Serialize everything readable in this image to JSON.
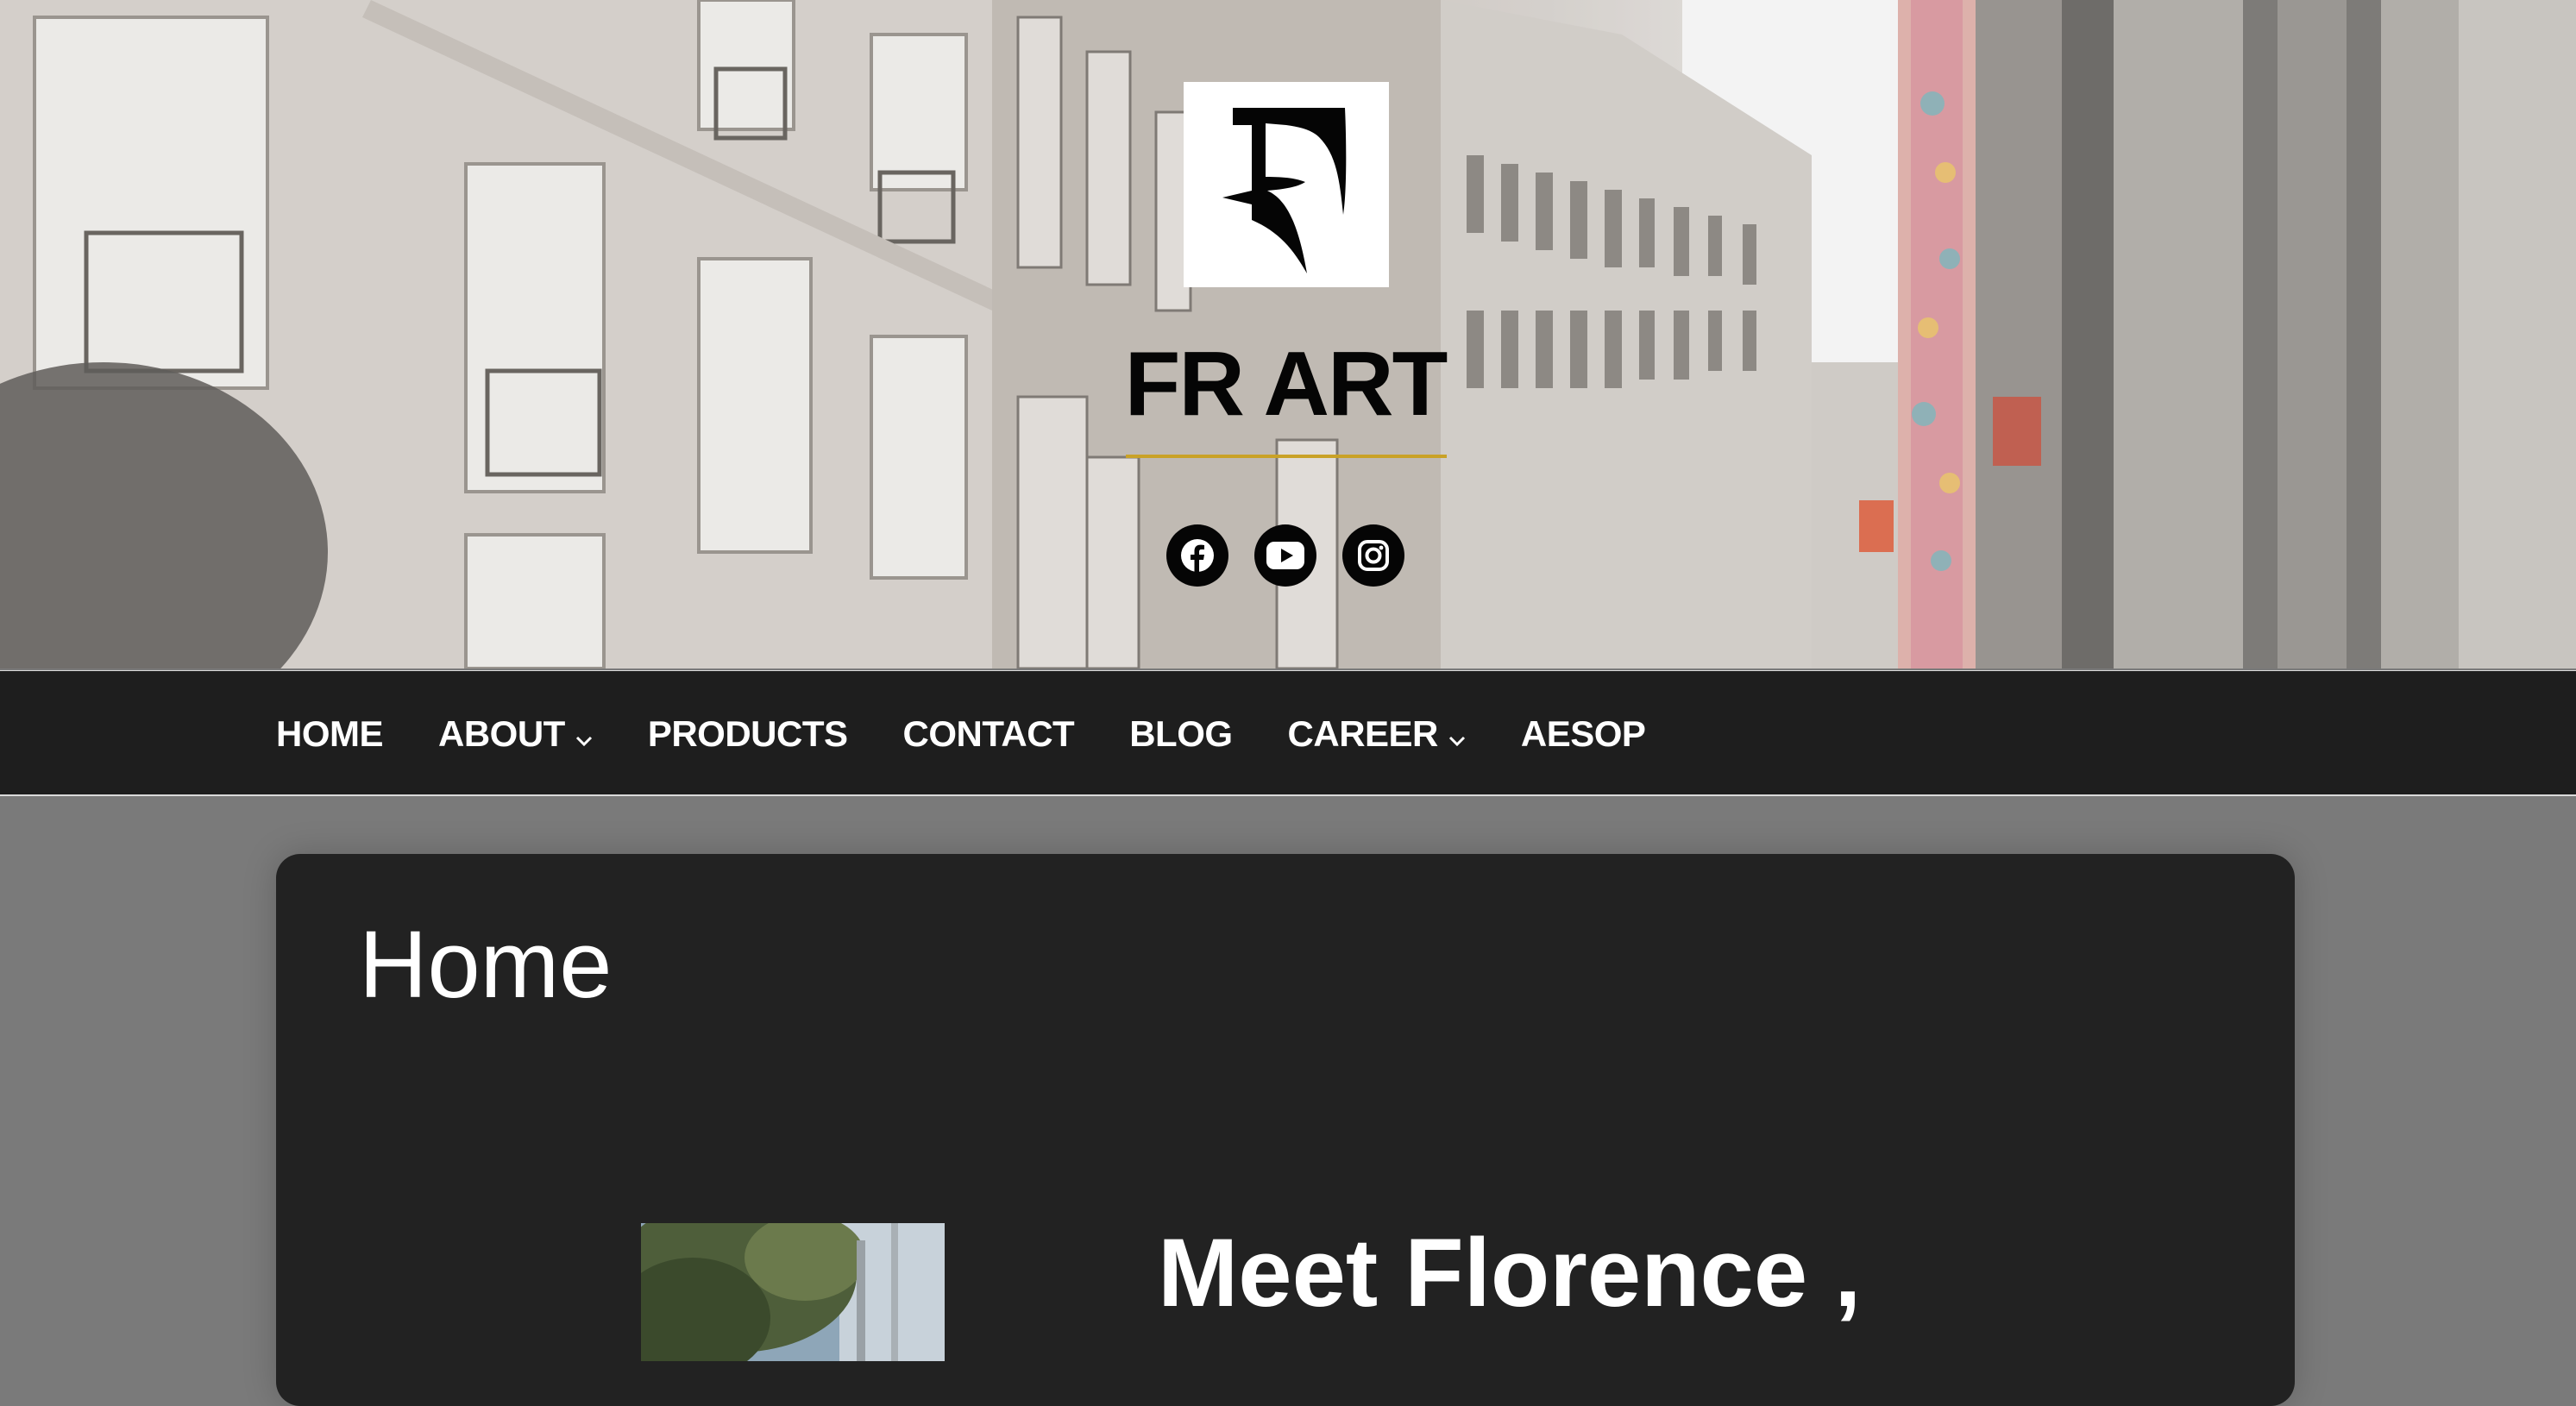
{
  "site": {
    "title": "FR ART",
    "logo_icon": "fr-art-logo-icon",
    "accent_color": "#c9a227"
  },
  "social": [
    {
      "name": "Facebook",
      "icon": "facebook-icon"
    },
    {
      "name": "YouTube",
      "icon": "youtube-icon"
    },
    {
      "name": "Instagram",
      "icon": "instagram-icon"
    }
  ],
  "nav": {
    "items": [
      {
        "label": "HOME",
        "has_submenu": false
      },
      {
        "label": "ABOUT",
        "has_submenu": true
      },
      {
        "label": "PRODUCTS",
        "has_submenu": false
      },
      {
        "label": "CONTACT",
        "has_submenu": false
      },
      {
        "label": "BLOG",
        "has_submenu": false
      },
      {
        "label": "CAREER",
        "has_submenu": true
      },
      {
        "label": "AESOP",
        "has_submenu": false
      }
    ]
  },
  "main": {
    "page_title": "Home",
    "intro_heading": "Meet Florence ,"
  }
}
